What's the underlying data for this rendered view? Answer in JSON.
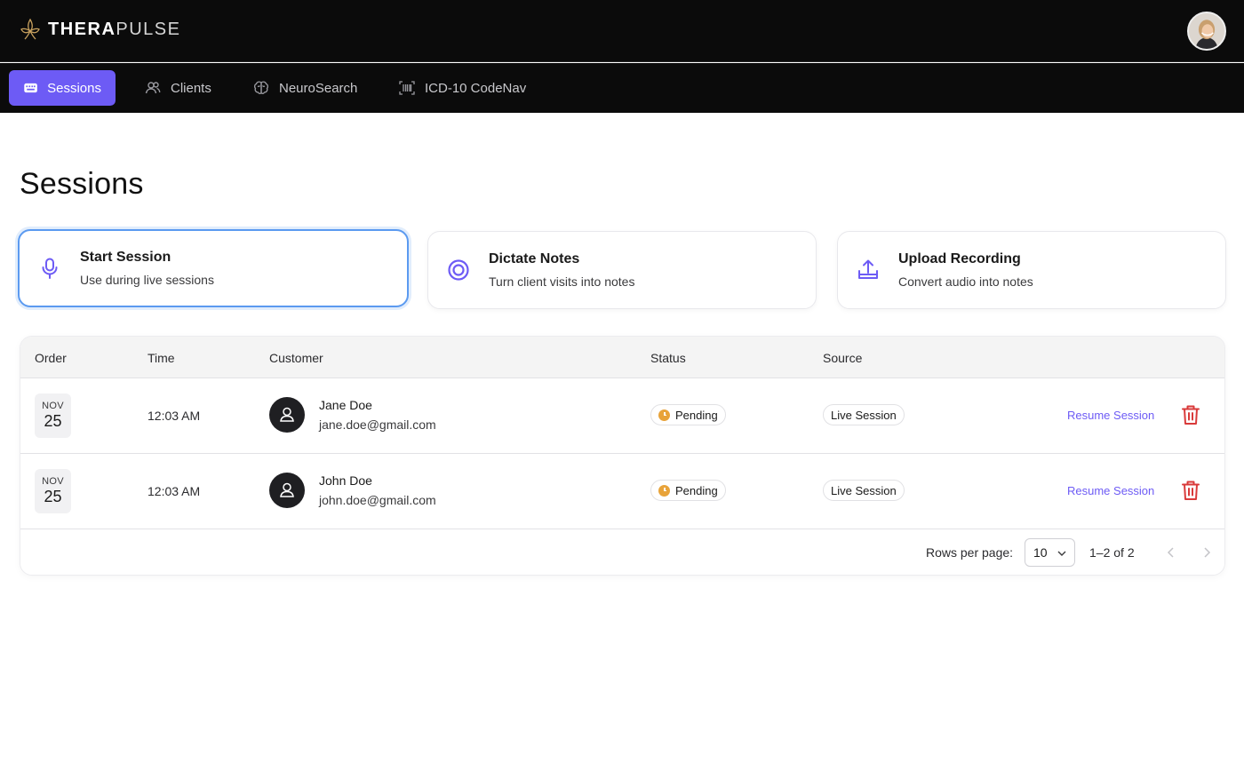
{
  "app": {
    "brand_bold": "THERA",
    "brand_light": "PULSE"
  },
  "nav": {
    "tabs": [
      {
        "label": "Sessions",
        "active": true,
        "icon": "sessions-icon"
      },
      {
        "label": "Clients",
        "active": false,
        "icon": "clients-icon"
      },
      {
        "label": "NeuroSearch",
        "active": false,
        "icon": "brain-icon"
      },
      {
        "label": "ICD-10 CodeNav",
        "active": false,
        "icon": "barcode-icon"
      }
    ]
  },
  "page": {
    "title": "Sessions"
  },
  "actions": [
    {
      "title": "Start Session",
      "subtitle": "Use during live sessions",
      "icon": "microphone-icon"
    },
    {
      "title": "Dictate Notes",
      "subtitle": "Turn client visits into notes",
      "icon": "record-icon"
    },
    {
      "title": "Upload Recording",
      "subtitle": "Convert audio into notes",
      "icon": "upload-icon"
    }
  ],
  "table": {
    "headers": {
      "order": "Order",
      "time": "Time",
      "customer": "Customer",
      "status": "Status",
      "source": "Source"
    },
    "rows": [
      {
        "month": "NOV",
        "day": "25",
        "time": "12:03 AM",
        "name": "Jane Doe",
        "email": "jane.doe@gmail.com",
        "status": "Pending",
        "source": "Live Session",
        "action": "Resume Session"
      },
      {
        "month": "NOV",
        "day": "25",
        "time": "12:03 AM",
        "name": "John Doe",
        "email": "john.doe@gmail.com",
        "status": "Pending",
        "source": "Live Session",
        "action": "Resume Session"
      }
    ],
    "footer": {
      "rows_per_page_label": "Rows per page:",
      "rows_per_page_value": "10",
      "range": "1–2 of 2"
    }
  },
  "colors": {
    "accent": "#6d5bf5",
    "pending": "#e8a33a",
    "danger": "#d93a3a",
    "focus": "#5b9af0"
  }
}
